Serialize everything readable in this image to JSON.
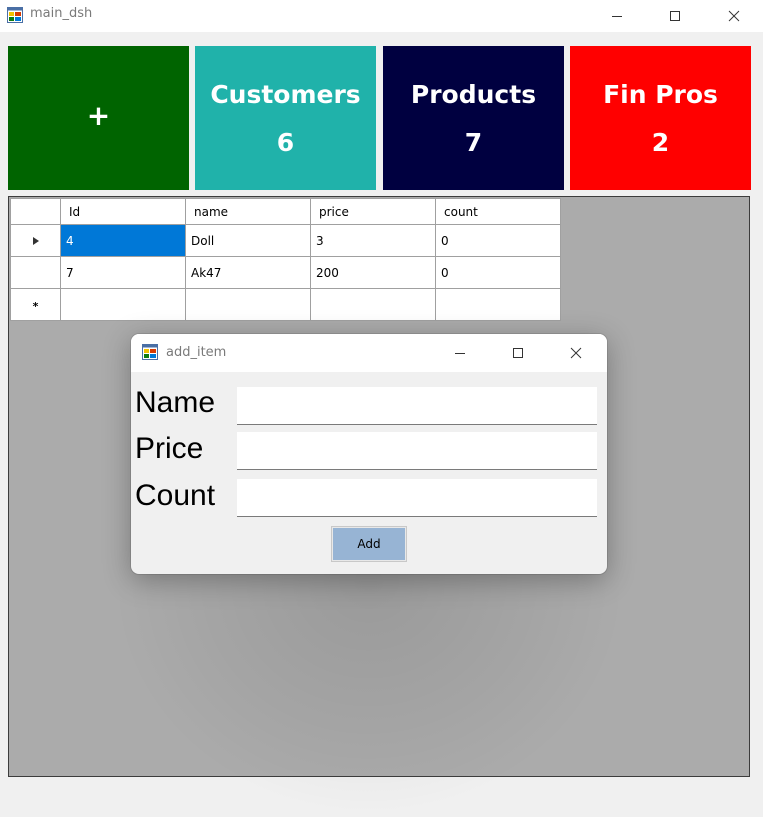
{
  "main_window": {
    "title": "main_dsh",
    "icon": "winforms-app-icon",
    "controls": [
      "minimize-icon",
      "maximize-icon",
      "close-icon"
    ]
  },
  "tiles": [
    {
      "label": "+",
      "count": "",
      "color": "#006400"
    },
    {
      "label": "Customers",
      "count": "6",
      "color": "#20b2aa"
    },
    {
      "label": "Products",
      "count": "7",
      "color": "#000040"
    },
    {
      "label": "Fin Pros",
      "count": "2",
      "color": "#ff0000"
    }
  ],
  "grid": {
    "columns": [
      "Id",
      "name",
      "price",
      "count"
    ],
    "rows": [
      {
        "Id": "4",
        "name": "Doll",
        "price": "3",
        "count": "0",
        "current": true
      },
      {
        "Id": "7",
        "name": "Ak47",
        "price": "200",
        "count": "0",
        "current": false
      }
    ],
    "new_row_marker": "*",
    "selection_color": "#0078d7",
    "background": "#ababab"
  },
  "dialog": {
    "title": "add_item",
    "labels": {
      "name": "Name",
      "price": "Price",
      "count": "Count"
    },
    "values": {
      "name": "",
      "price": "",
      "count": ""
    },
    "add_label": "Add",
    "add_color": "#97b4d4"
  }
}
